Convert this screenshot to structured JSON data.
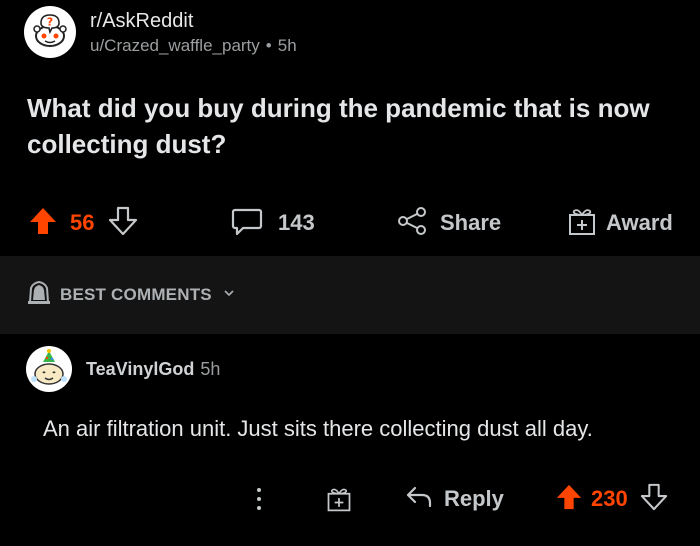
{
  "post": {
    "subreddit": "r/AskReddit",
    "author": "u/Crazed_waffle_party",
    "separator": "•",
    "age": "5h",
    "title": "What did you buy during the pandemic that is now collecting dust?",
    "upvotes": "56",
    "comments": "143",
    "share_label": "Share",
    "award_label": "Award"
  },
  "sort": {
    "label": "BEST COMMENTS"
  },
  "comment": {
    "author": "TeaVinylGod",
    "age": "5h",
    "body": "An air filtration unit. Just sits there collecting dust all day.",
    "reply_label": "Reply",
    "score": "230"
  },
  "colors": {
    "accent": "#ff4500",
    "background": "#000000",
    "sort_bar": "#141414"
  },
  "icons": [
    "subreddit-avatar-icon",
    "upvote-icon",
    "downvote-icon",
    "comment-icon",
    "share-icon",
    "award-icon",
    "shield-icon",
    "chevron-down-icon",
    "user-avatar-icon",
    "more-icon",
    "reply-icon"
  ]
}
